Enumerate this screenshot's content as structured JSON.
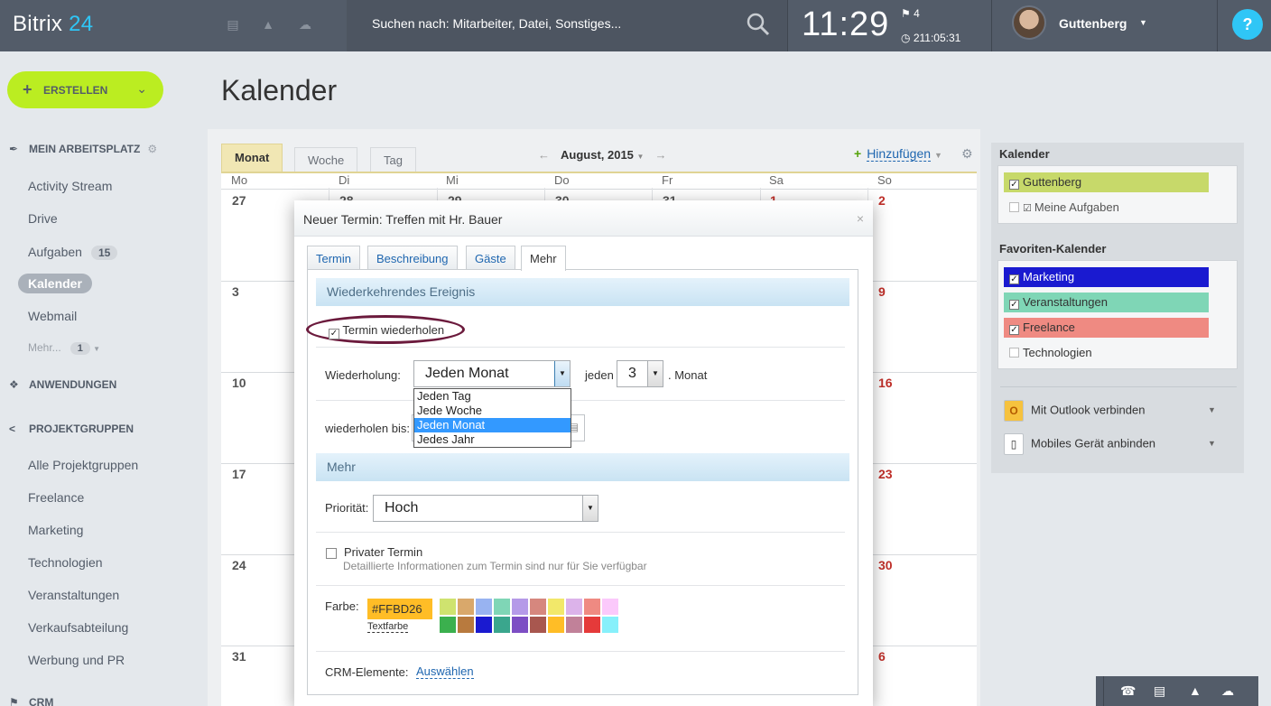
{
  "topbar": {
    "logo_text": "Bitrix",
    "logo_num": "24",
    "search_placeholder": "Suchen nach: Mitarbeiter, Datei, Sonstiges...",
    "clock": "11:29",
    "flag_count": "4",
    "timer": "211:05:31",
    "user_name": "Guttenberg",
    "help": "?"
  },
  "sidebar": {
    "create_label": "ERSTELLEN",
    "sections": {
      "workspace": "MEIN ARBEITSPLATZ",
      "apps": "ANWENDUNGEN",
      "groups": "PROJEKTGRUPPEN",
      "crm": "CRM"
    },
    "items": [
      "Activity Stream",
      "Drive",
      "Aufgaben",
      "Kalender",
      "Webmail"
    ],
    "tasks_badge": "15",
    "more_label": "Mehr...",
    "more_badge": "1",
    "group_items": [
      "Alle Projektgruppen",
      "Freelance",
      "Marketing",
      "Technologien",
      "Veranstaltungen",
      "Verkaufsabteilung",
      "Werbung und PR"
    ]
  },
  "page": {
    "title": "Kalender"
  },
  "calendar": {
    "view_tabs": [
      "Monat",
      "Woche",
      "Tag"
    ],
    "active_view": "Monat",
    "month_label": "August, 2015",
    "add_label": "Hinzufügen",
    "day_names": [
      "Mo",
      "Di",
      "Mi",
      "Do",
      "Fr",
      "Sa",
      "So"
    ],
    "header_row_dates": [
      "28",
      "29",
      "30",
      "31",
      "1"
    ],
    "week_first_days": [
      "27",
      "3",
      "10",
      "17",
      "24",
      "31"
    ],
    "week_sundays": [
      "2",
      "9",
      "16",
      "23",
      "30",
      "6"
    ]
  },
  "right_panel": {
    "calendars_title": "Kalender",
    "calendars": [
      {
        "label": "Guttenberg",
        "checked": true,
        "color": "#c7d96a"
      },
      {
        "label": "Meine Aufgaben",
        "checked": false,
        "color": ""
      }
    ],
    "favorites_title": "Favoriten-Kalender",
    "favorites": [
      {
        "label": "Marketing",
        "checked": true,
        "color": "#1a1ad0"
      },
      {
        "label": "Veranstaltungen",
        "checked": true,
        "color": "#7fd6b6"
      },
      {
        "label": "Freelance",
        "checked": true,
        "color": "#ef8a82"
      },
      {
        "label": "Technologien",
        "checked": false,
        "color": ""
      }
    ],
    "outlook_label": "Mit Outlook verbinden",
    "mobile_label": "Mobiles Gerät anbinden"
  },
  "dialog": {
    "title": "Neuer Termin: Treffen mit Hr. Bauer",
    "tabs": [
      "Termin",
      "Beschreibung",
      "Gäste",
      "Mehr"
    ],
    "active_tab": "Mehr",
    "section_recurring": "Wiederkehrendes Ereignis",
    "repeat_checkbox_label": "Termin wiederholen",
    "repeat_checked": true,
    "repetition_label": "Wiederholung:",
    "repetition_value": "Jeden Monat",
    "repetition_options": [
      "Jeden Tag",
      "Jede Woche",
      "Jeden Monat",
      "Jedes Jahr"
    ],
    "every_label": "jeden",
    "interval_value": "3",
    "unit_label": ". Monat",
    "repeat_until_label": "wiederholen bis:",
    "section_more": "Mehr",
    "priority_label": "Priorität:",
    "priority_value": "Hoch",
    "private_label": "Privater Termin",
    "private_note": "Detaillierte Informationen zum Termin sind nur für Sie verfügbar",
    "color_label": "Farbe:",
    "color_value": "#FFBD26",
    "text_color_label": "Textfarbe",
    "swatches_row1": [
      "#cfe36f",
      "#d9a86b",
      "#98b3f1",
      "#7fd6b6",
      "#b59ae8",
      "#d6877e",
      "#f2e86a",
      "#dcb3ea",
      "#ef8a82",
      "#fbc9fb"
    ],
    "swatches_row2": [
      "#3bb04e",
      "#b87a3e",
      "#1a1ad0",
      "#3aa68d",
      "#7d4ec4",
      "#a8574f",
      "#ffbd26",
      "#c18199",
      "#e53a3a",
      "#87f0fb"
    ],
    "crm_label": "CRM-Elemente:",
    "crm_link": "Auswählen"
  }
}
